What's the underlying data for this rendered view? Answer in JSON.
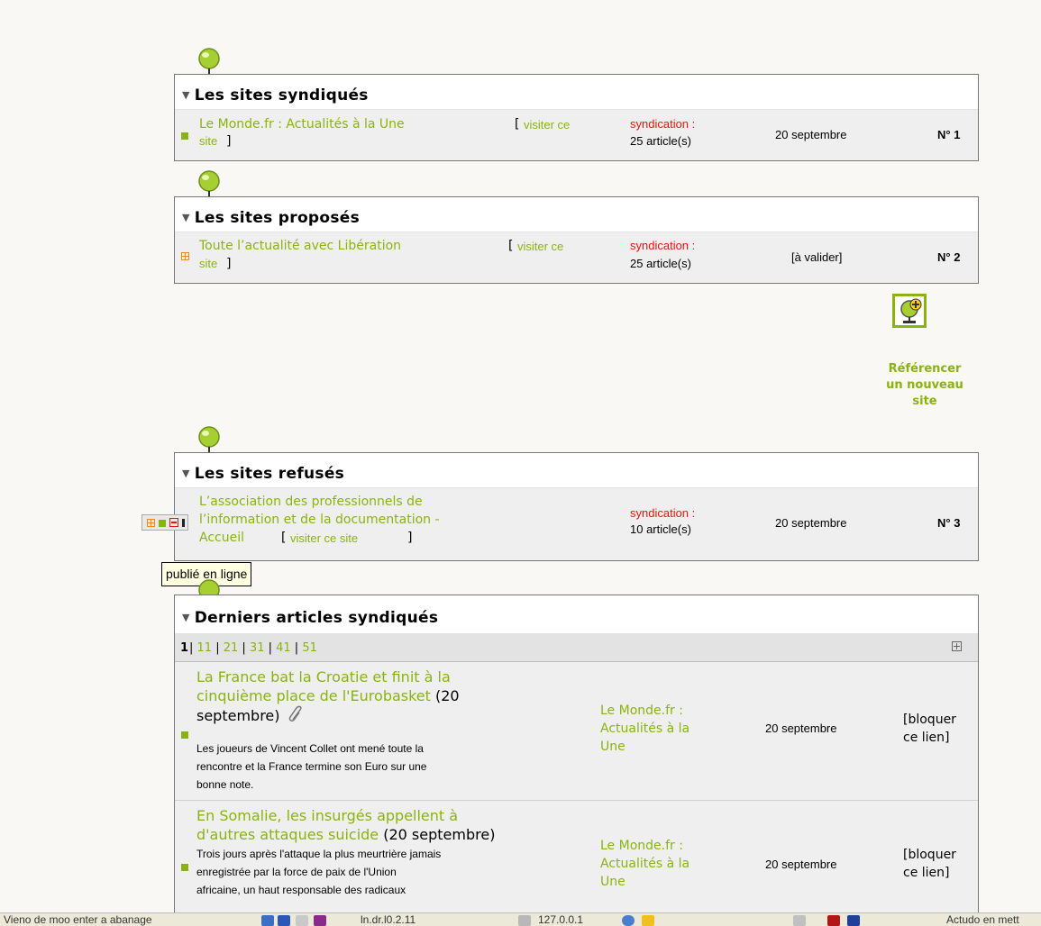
{
  "syndicated": {
    "title": "Les sites syndiqués",
    "item": {
      "name_line1": "Le Monde.fr : Actualités à la Une",
      "visit_open": "[",
      "visit_part1": "visiter ce",
      "visit_part2": "site",
      "visit_close": "]",
      "synd_label": "syndication :",
      "synd_count": "25 article(s)",
      "date": "20 septembre",
      "number": "N° 1"
    }
  },
  "proposed": {
    "title": "Les sites proposés",
    "item": {
      "name_line1": "Toute l’actualité avec Libération",
      "visit_open": "[",
      "visit_part1": "visiter ce",
      "visit_part2": "site",
      "visit_close": "]",
      "synd_label": "syndication :",
      "synd_count": "25 article(s)",
      "status": "[à valider]",
      "number": "N° 2"
    }
  },
  "new_site": {
    "line1": "Référencer",
    "line2": "un nouveau",
    "line3": "site"
  },
  "refused": {
    "title": "Les sites refusés",
    "item": {
      "line1": "L’association des professionnels de",
      "line2": "l’information et de la documentation -",
      "line3": "Accueil",
      "visit": "visiter ce site",
      "synd_label": "syndication :",
      "synd_count": "10 article(s)",
      "date": "20 septembre",
      "number": "N° 3"
    }
  },
  "tooltip": "publié en ligne",
  "articles": {
    "title": "Derniers articles syndiqués",
    "pager": {
      "current": "1",
      "pages": [
        "11",
        "21",
        "31",
        "41",
        "51"
      ]
    },
    "rows": [
      {
        "title_line1": "La France bat la Croatie et finit à la",
        "title_line2": "cinquième place de l'Eurobasket",
        "date_inline_a": " (20",
        "date_inline_b": "septembre)",
        "desc_line1": "Les joueurs de Vincent Collet ont mené toute la",
        "desc_line2": "rencontre et la France termine son Euro sur une",
        "desc_line3": "bonne note.",
        "source_line1": "Le Monde.fr :",
        "source_line2": "Actualités à la",
        "source_line3": "Une",
        "date": "20 septembre",
        "action_line1": "[bloquer",
        "action_line2": "ce lien]"
      },
      {
        "title_line1": "En Somalie, les insurgés appellent à",
        "title_line2": "d'autres attaques suicide",
        "date_inline_a": " (20 septembre)",
        "desc_line1": "Trois jours après l'attaque la plus meurtrière jamais",
        "desc_line2": "enregistrée par la force de paix de l'Union",
        "desc_line3": "africaine, un haut responsable des radicaux",
        "source_line1": "Le Monde.fr :",
        "source_line2": "Actualités à la",
        "source_line3": "Une",
        "date": "20 septembre",
        "action_line1": "[bloquer",
        "action_line2": "ce lien]"
      }
    ]
  },
  "taskbar": {
    "left_text": "Vieno de moo enter a abanage",
    "mid_text": "ln.dr.l0.2.11",
    "ip_text": "127.0.0.1",
    "right_text": "Actudo en mett"
  },
  "colors": {
    "accent": "#8ab30f",
    "syndication": "#e8150c"
  }
}
